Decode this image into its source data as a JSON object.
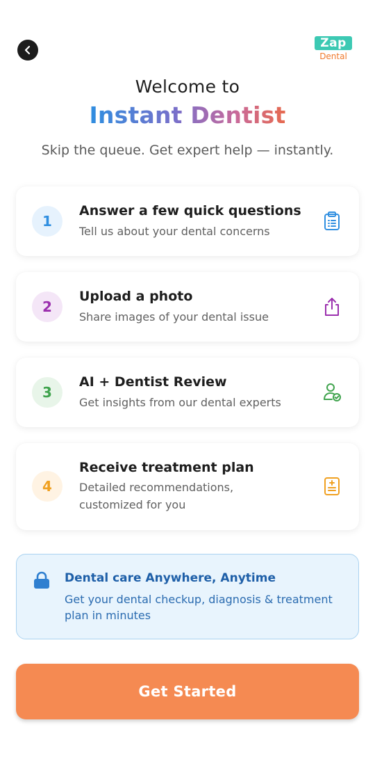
{
  "header": {
    "back_icon": "chevron-left-icon",
    "logo": {
      "line1": "Zap",
      "line2": "Dental"
    }
  },
  "hero": {
    "welcome": "Welcome to",
    "brand": "Instant Dentist",
    "tagline": "Skip the queue. Get expert help — instantly."
  },
  "steps": [
    {
      "number": "1",
      "title": "Answer a few quick questions",
      "description": "Tell us about your dental concerns",
      "icon": "clipboard-list-icon",
      "color": "#2f8ee0",
      "bg": "#e6f2fd"
    },
    {
      "number": "2",
      "title": "Upload a photo",
      "description": "Share images of your dental issue",
      "icon": "upload-icon",
      "color": "#9b2fae",
      "bg": "#f4e6f7"
    },
    {
      "number": "3",
      "title": "AI + Dentist Review",
      "description": "Get insights from our dental experts",
      "icon": "user-check-icon",
      "color": "#3fa34d",
      "bg": "#e8f5e9"
    },
    {
      "number": "4",
      "title": "Receive treatment plan",
      "description": "Detailed recommendations, customized for you",
      "icon": "medical-plan-icon",
      "color": "#f0a020",
      "bg": "#fff3e3"
    }
  ],
  "info": {
    "icon": "lock-icon",
    "title": "Dental care Anywhere, Anytime",
    "text": "Get your dental checkup, diagnosis & treatment plan in minutes"
  },
  "cta": {
    "label": "Get Started"
  },
  "colors": {
    "accent": "#f58a52",
    "brand_teal": "#3cc9b3",
    "info_bg": "#e8f4fd",
    "info_text": "#1e5fa8"
  }
}
